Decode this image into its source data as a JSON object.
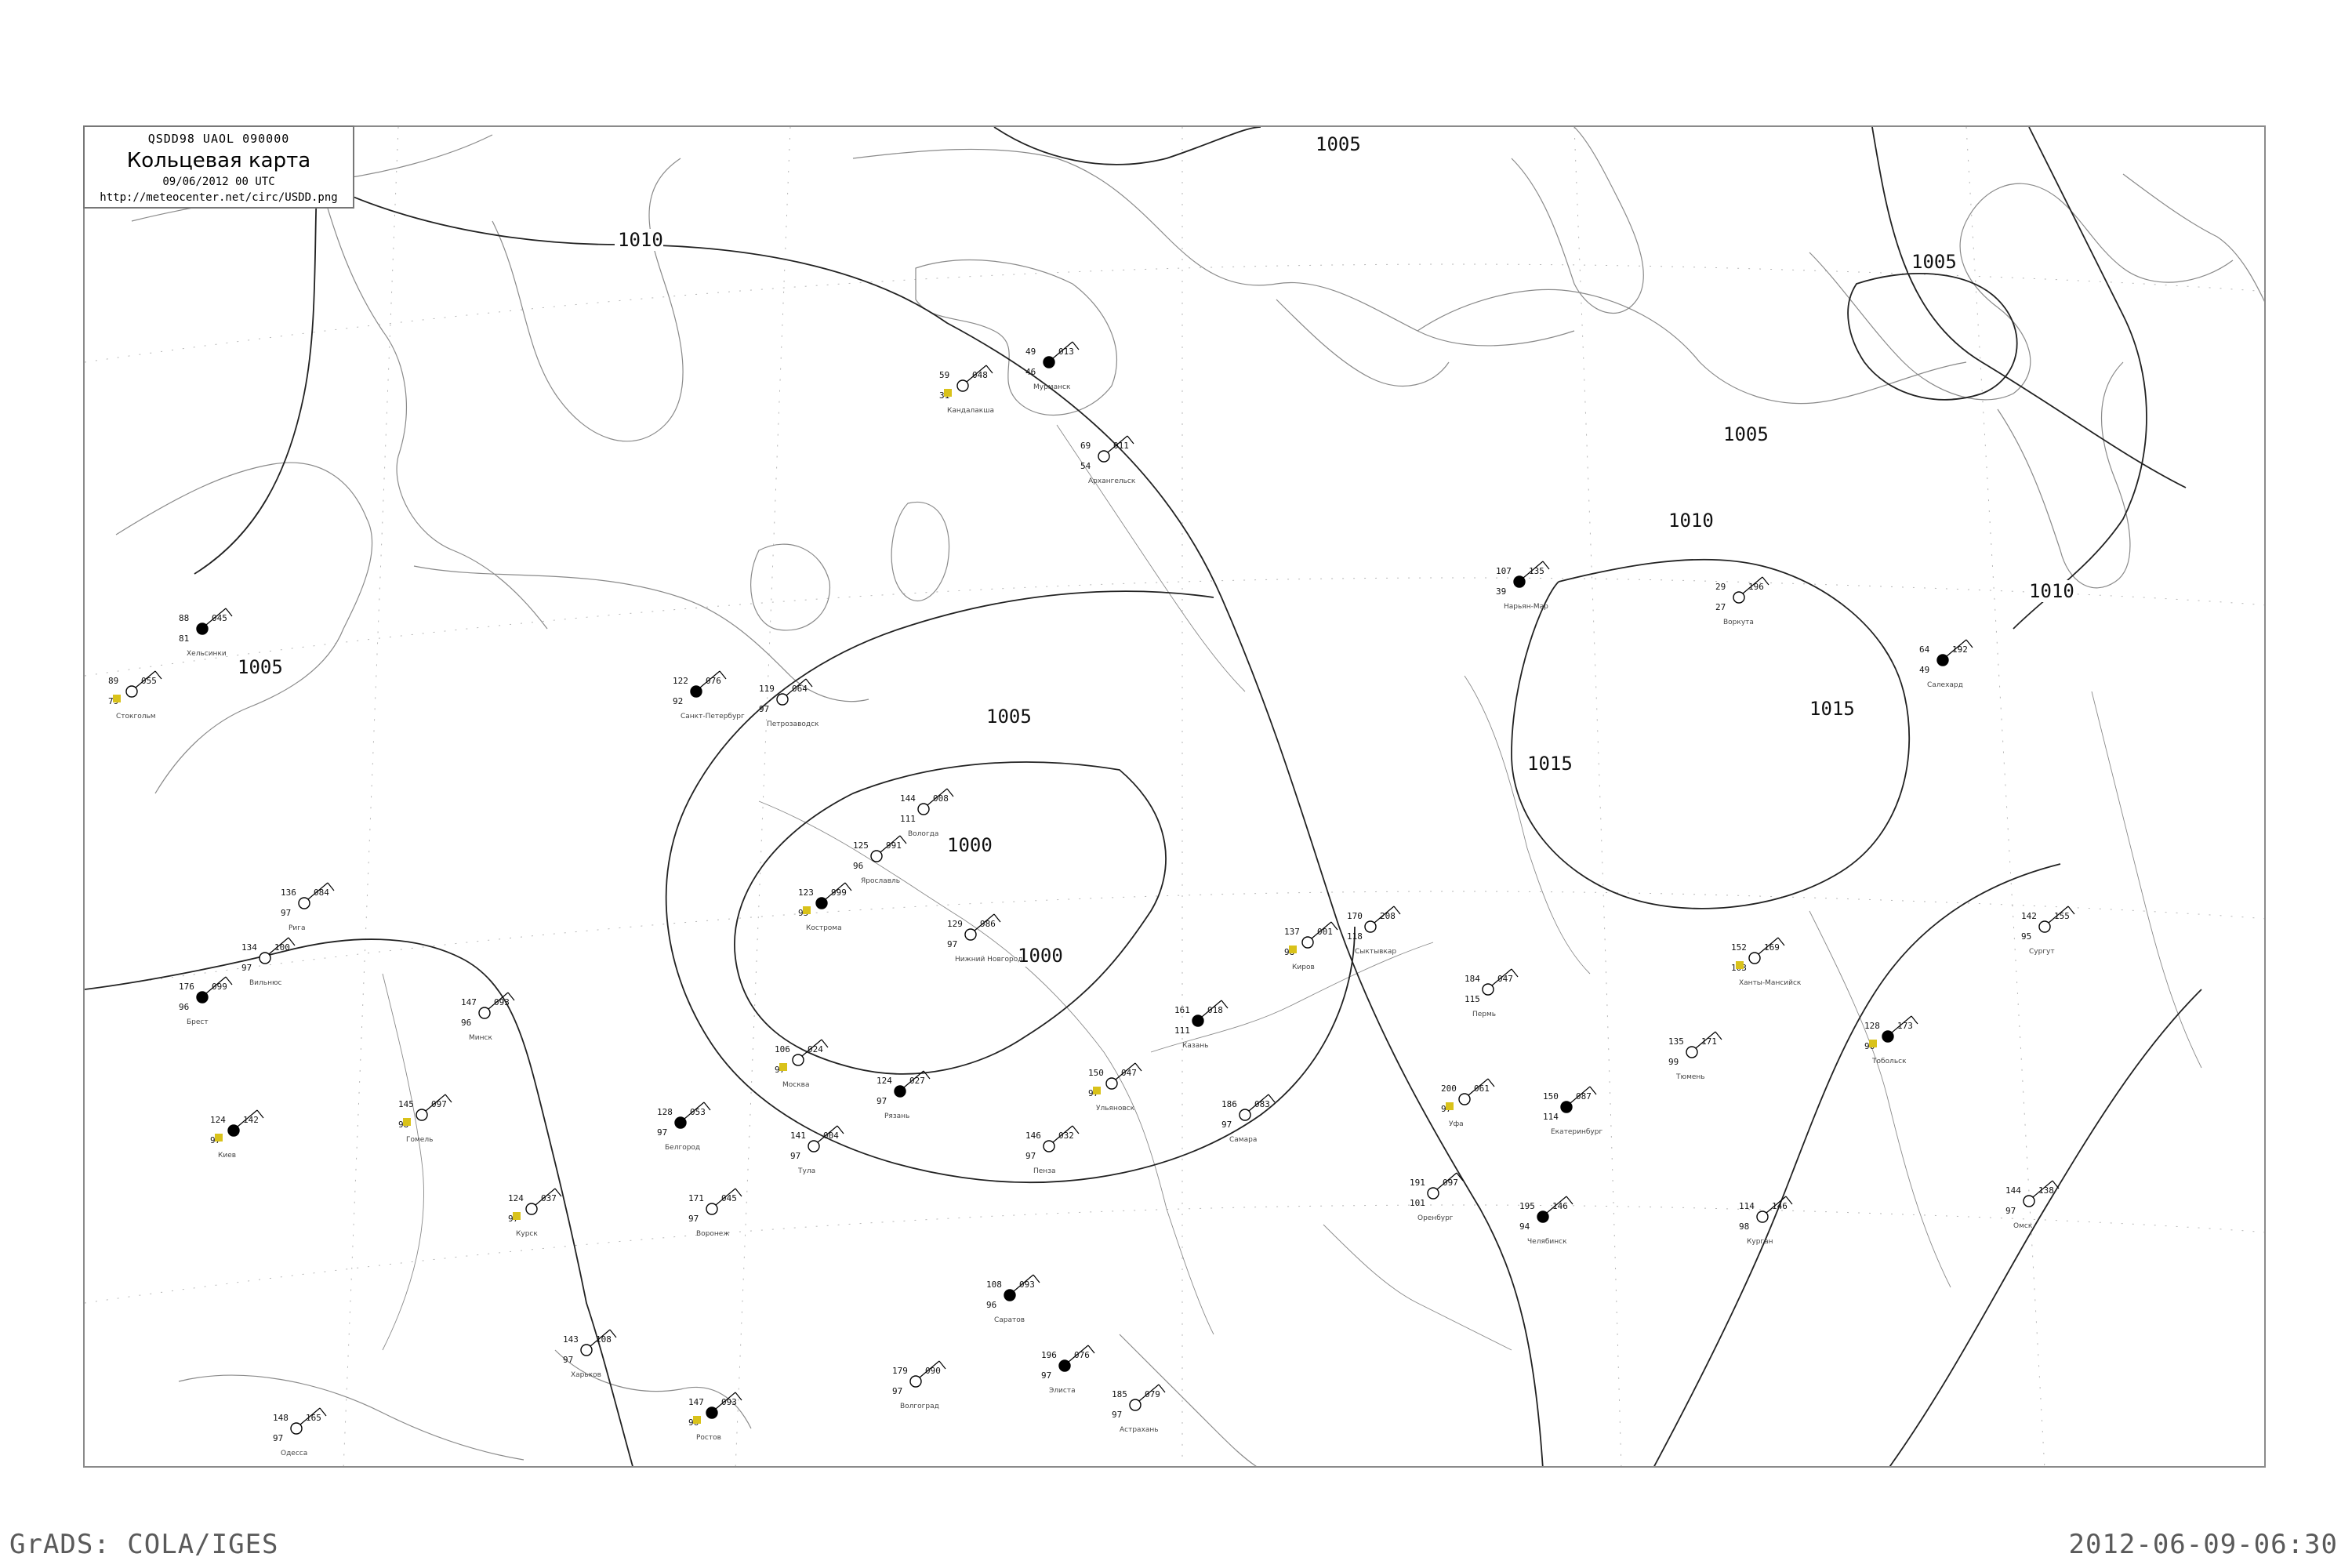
{
  "header": {
    "code_line": "QSDD98  UAOL  090000",
    "title": "Кольцевая карта",
    "date_line": "09/06/2012 00 UTC",
    "url": "http://meteocenter.net/circ/USDD.png"
  },
  "footer": {
    "left": "GrADS: COLA/IGES",
    "right": "2012-06-09-06:30"
  },
  "isobar_labels": [
    "1005",
    "1010",
    "1005",
    "1005",
    "1000",
    "1000",
    "1005",
    "1015",
    "1015",
    "1010",
    "1010",
    "1005"
  ],
  "stations": [
    {
      "name": "Мурманск",
      "pressure": "013",
      "temp": "49",
      "dew": "46"
    },
    {
      "name": "Кандалакша",
      "pressure": "048",
      "temp": "59",
      "dew": "31"
    },
    {
      "name": "Архангельск",
      "pressure": "011",
      "temp": "69",
      "dew": "54"
    },
    {
      "name": "Нарьян-Мар",
      "pressure": "135",
      "temp": "107",
      "dew": "39"
    },
    {
      "name": "Сыктывкар",
      "pressure": "208",
      "temp": "170",
      "dew": "118"
    },
    {
      "name": "Москва",
      "pressure": "024",
      "temp": "106",
      "dew": "97"
    },
    {
      "name": "Санкт-Петербург",
      "pressure": "076",
      "temp": "122",
      "dew": "92"
    },
    {
      "name": "Петрозаводск",
      "pressure": "064",
      "temp": "119",
      "dew": "97"
    },
    {
      "name": "Вологда",
      "pressure": "008",
      "temp": "144",
      "dew": "111"
    },
    {
      "name": "Кострома",
      "pressure": "999",
      "temp": "123",
      "dew": "95"
    },
    {
      "name": "Ярославль",
      "pressure": "991",
      "temp": "125",
      "dew": "96"
    },
    {
      "name": "Нижний Новгород",
      "pressure": "986",
      "temp": "129",
      "dew": "97"
    },
    {
      "name": "Казань",
      "pressure": "018",
      "temp": "161",
      "dew": "111"
    },
    {
      "name": "Киров",
      "pressure": "001",
      "temp": "137",
      "dew": "98"
    },
    {
      "name": "Пермь",
      "pressure": "047",
      "temp": "184",
      "dew": "115"
    },
    {
      "name": "Екатеринбург",
      "pressure": "087",
      "temp": "150",
      "dew": "114"
    },
    {
      "name": "Тюмень",
      "pressure": "171",
      "temp": "135",
      "dew": "99"
    },
    {
      "name": "Ханты-Мансийск",
      "pressure": "169",
      "temp": "152",
      "dew": "103"
    },
    {
      "name": "Салехард",
      "pressure": "192",
      "temp": "64",
      "dew": "49"
    },
    {
      "name": "Воркута",
      "pressure": "196",
      "temp": "29",
      "dew": "27"
    },
    {
      "name": "Минск",
      "pressure": "093",
      "temp": "147",
      "dew": "96"
    },
    {
      "name": "Киев",
      "pressure": "142",
      "temp": "124",
      "dew": "97"
    },
    {
      "name": "Рига",
      "pressure": "084",
      "temp": "136",
      "dew": "97"
    },
    {
      "name": "Вильнюс",
      "pressure": "100",
      "temp": "134",
      "dew": "97"
    },
    {
      "name": "Хельсинки",
      "pressure": "045",
      "temp": "88",
      "dew": "81"
    },
    {
      "name": "Стокгольм",
      "pressure": "055",
      "temp": "89",
      "dew": "79"
    },
    {
      "name": "Самара",
      "pressure": "083",
      "temp": "186",
      "dew": "97"
    },
    {
      "name": "Саратов",
      "pressure": "093",
      "temp": "108",
      "dew": "96"
    },
    {
      "name": "Оренбург",
      "pressure": "097",
      "temp": "191",
      "dew": "101"
    },
    {
      "name": "Уфа",
      "pressure": "061",
      "temp": "200",
      "dew": "97"
    },
    {
      "name": "Челябинск",
      "pressure": "146",
      "temp": "195",
      "dew": "94"
    },
    {
      "name": "Курган",
      "pressure": "146",
      "temp": "114",
      "dew": "98"
    },
    {
      "name": "Омск",
      "pressure": "138",
      "temp": "144",
      "dew": "97"
    },
    {
      "name": "Тобольск",
      "pressure": "173",
      "temp": "128",
      "dew": "96"
    },
    {
      "name": "Сургут",
      "pressure": "155",
      "temp": "142",
      "dew": "95"
    },
    {
      "name": "Воронеж",
      "pressure": "045",
      "temp": "171",
      "dew": "97"
    },
    {
      "name": "Белгород",
      "pressure": "053",
      "temp": "128",
      "dew": "97"
    },
    {
      "name": "Курск",
      "pressure": "037",
      "temp": "124",
      "dew": "97"
    },
    {
      "name": "Тула",
      "pressure": "004",
      "temp": "141",
      "dew": "97"
    },
    {
      "name": "Рязань",
      "pressure": "027",
      "temp": "124",
      "dew": "97"
    },
    {
      "name": "Пенза",
      "pressure": "032",
      "temp": "146",
      "dew": "97"
    },
    {
      "name": "Ульяновск",
      "pressure": "047",
      "temp": "150",
      "dew": "97"
    },
    {
      "name": "Элиста",
      "pressure": "076",
      "temp": "196",
      "dew": "97"
    },
    {
      "name": "Волгоград",
      "pressure": "090",
      "temp": "179",
      "dew": "97"
    },
    {
      "name": "Астрахань",
      "pressure": "079",
      "temp": "185",
      "dew": "97"
    },
    {
      "name": "Ростов",
      "pressure": "093",
      "temp": "147",
      "dew": "96"
    },
    {
      "name": "Харьков",
      "pressure": "108",
      "temp": "143",
      "dew": "97"
    },
    {
      "name": "Одесса",
      "pressure": "165",
      "temp": "148",
      "dew": "97"
    },
    {
      "name": "Брест",
      "pressure": "099",
      "temp": "176",
      "dew": "96"
    },
    {
      "name": "Гомель",
      "pressure": "097",
      "temp": "145",
      "dew": "98"
    }
  ],
  "colors": {
    "frame": "#8a8a8a",
    "isobar": "#222222",
    "coast": "#8a8a8a",
    "grid": "#b5b5b5",
    "marker_green": "#17a04a",
    "marker_yellow": "#d9c21a",
    "marker_red": "#e0305a",
    "marker_blue": "#2f6fd0"
  }
}
